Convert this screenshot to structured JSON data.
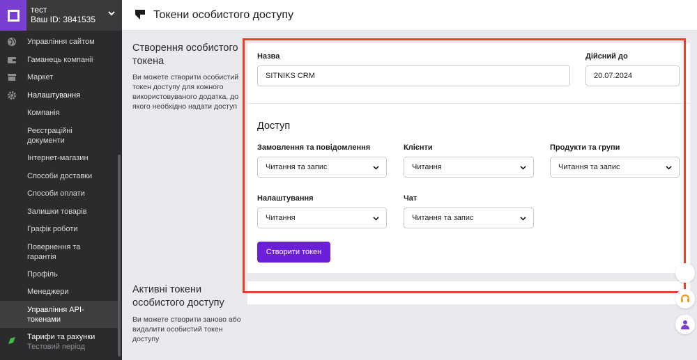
{
  "account": {
    "name": "тест",
    "id_label": "Ваш ID: 3841535"
  },
  "sidebar": {
    "items": [
      {
        "label": "Управління сайтом",
        "icon": "globe-icon"
      },
      {
        "label": "Гаманець компанії",
        "icon": "wallet-icon"
      },
      {
        "label": "Маркет",
        "icon": "store-icon"
      },
      {
        "label": "Налаштування",
        "icon": "gear-icon"
      }
    ],
    "subitems": [
      {
        "label": "Компанія"
      },
      {
        "label_line1": "Реєстраційні",
        "label_line2": "документи"
      },
      {
        "label": "Інтернет-магазин"
      },
      {
        "label": "Способи доставки"
      },
      {
        "label": "Способи оплати"
      },
      {
        "label": "Залишки товарів"
      },
      {
        "label": "Графік роботи"
      },
      {
        "label_line1": "Повернення та",
        "label_line2": "гарантія"
      },
      {
        "label": "Профіль"
      },
      {
        "label": "Менеджери"
      },
      {
        "label_line1": "Управління API-",
        "label_line2": "токенами"
      }
    ],
    "tariffs": {
      "label": "Тарифи та рахунки",
      "sublabel": "Тестовий період",
      "icon": "leaf-icon"
    }
  },
  "header": {
    "title": "Токени особистого доступу"
  },
  "create_section": {
    "title": "Створення особистого токена",
    "description": "Ви можете створити особистий токен доступу для кожного використовуваного додатка, до якого необхідно надати доступ"
  },
  "active_section": {
    "title": "Активні токени особистого доступу",
    "description": "Ви можете створити заново або видалити особистий токен доступу"
  },
  "form": {
    "name_label": "Назва",
    "name_value": "SITNIKS CRM",
    "valid_label": "Дійсний до",
    "valid_value": "20.07.2024",
    "access_title": "Доступ",
    "permissions": [
      {
        "label": "Замовлення та повідомлення",
        "value": "Читання та запис"
      },
      {
        "label": "Клієнти",
        "value": "Читання"
      },
      {
        "label": "Продукти та групи",
        "value": "Читання та запис"
      },
      {
        "label": "Налаштування",
        "value": "Читання"
      },
      {
        "label": "Чат",
        "value": "Читання та запис"
      }
    ],
    "submit_label": "Створити токен"
  },
  "colors": {
    "accent": "#6c1fd8",
    "highlight": "#e8402c",
    "sidebar": "#2b2b2d",
    "logo": "#7a3fd1"
  }
}
